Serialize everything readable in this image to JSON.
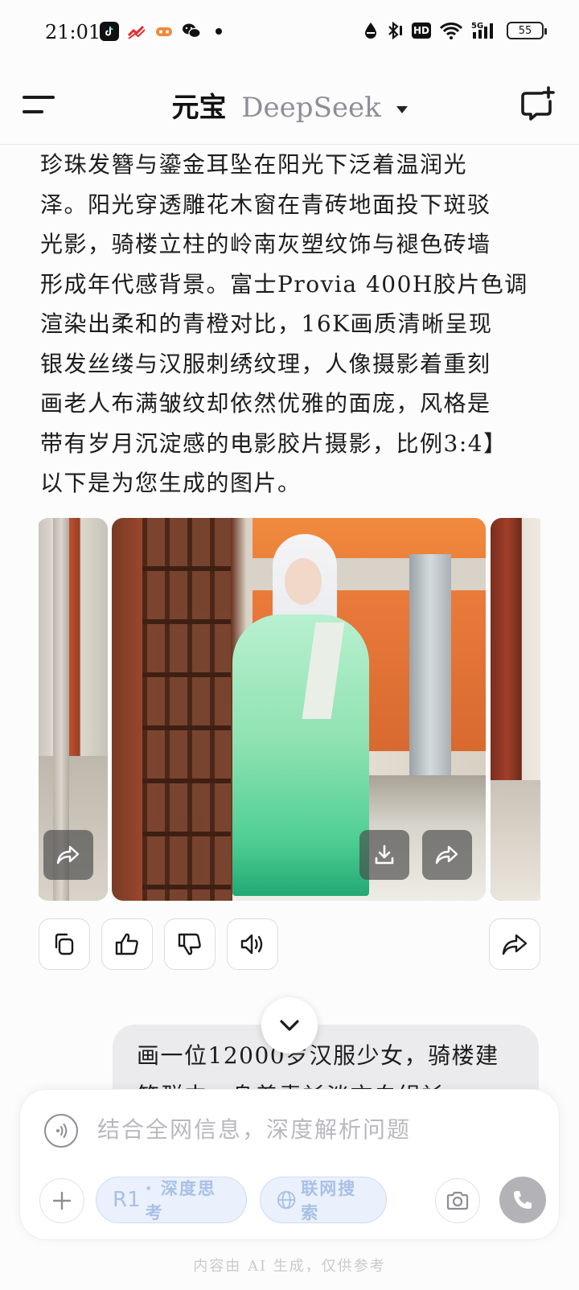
{
  "status_bar": {
    "time": "21:01",
    "battery": "55",
    "app_icons": [
      "tiktok-icon",
      "stock-app-icon",
      "game-app-icon",
      "wechat-icon",
      "more-dot-icon"
    ],
    "system_icons": [
      "dnd-drop-icon",
      "bluetooth-icon",
      "hd-icon",
      "wifi-icon",
      "5g-signal-icon",
      "battery-icon"
    ]
  },
  "header": {
    "app_name": "元宝",
    "model_name": "DeepSeek"
  },
  "message": {
    "lines": [
      "珍珠发簪与鎏金耳坠在阳光下泛着温润光",
      "泽。阳光穿透雕花木窗在青砖地面投下斑驳",
      "光影，骑楼立柱的岭南灰塑纹饰与褪色砖墙",
      "形成年代感背景。富士Provia 400H胶片色调",
      "渲染出柔和的青橙对比，16K画质清晰呈现",
      "银发丝缕与汉服刺绣纹理，人像摄影着重刻",
      "画老人布满皱纹却依然优雅的面庞，风格是",
      "带有岁月沉淀感的电影胶片摄影，比例3:4】",
      "以下是为您生成的图片。"
    ]
  },
  "images": {
    "left_partial": "previous-generated-image",
    "main": "generated-image-hanfu-girl",
    "right_partial": "next-generated-image"
  },
  "user_bubble": {
    "line1": "画一位12000岁汉服少女，骑楼建",
    "line2": "筑群中，身着青衫淡衣白绢衫"
  },
  "composer": {
    "placeholder": "结合全网信息，深度解析问题",
    "chip_r1_prefix": "R1",
    "chip_r1_label": "· 深度思考",
    "chip_web_label": "联网搜索"
  },
  "footer": {
    "note": "内容由 AI 生成，仅供参考"
  },
  "colors": {
    "background": "#fcfcfd",
    "chip_bg": "#eaf1fc",
    "chip_text": "#a9c0e6",
    "send_button": "#b3b3b7"
  }
}
